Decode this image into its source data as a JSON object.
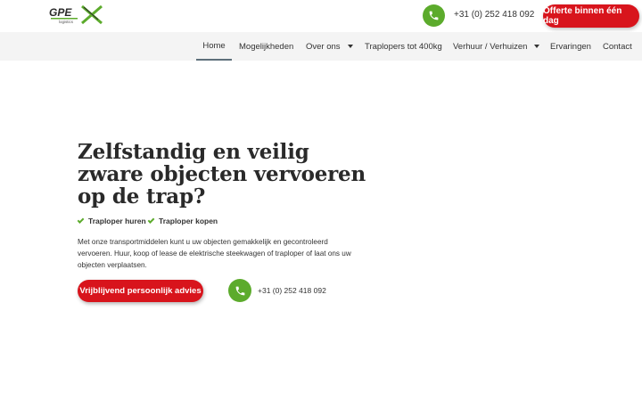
{
  "header": {
    "phone": "+31 (0) 252 418 092",
    "quote_button": "Offerte binnen één dag"
  },
  "nav": {
    "items": [
      {
        "label": "Home",
        "active": true
      },
      {
        "label": "Mogelijkheden"
      },
      {
        "label": "Over ons",
        "dropdown": true
      },
      {
        "label": "Traplopers tot 400kg"
      },
      {
        "label": "Verhuur / Verhuizen",
        "dropdown": true
      },
      {
        "label": "Ervaringen"
      },
      {
        "label": "Contact"
      }
    ]
  },
  "hero": {
    "title": "Zelfstandig en veilig zware objecten vervoeren op de trap?",
    "checks": [
      "Traploper huren",
      "Traploper kopen"
    ],
    "description": "Met onze transportmiddelen kunt u uw objecten gemakkelijk en gecontroleerd vervoeren. Huur, koop of lease de elektrische steekwagen of traploper of laat ons uw objecten verplaatsen.",
    "cta_button": "Vrijblijvend persoonlijk advies",
    "phone": "+31 (0) 252 418 092"
  },
  "colors": {
    "brand_red": "#d8141c",
    "brand_green": "#5cab2c"
  },
  "icons": {
    "phone": "phone-icon",
    "check": "check-icon",
    "dropdown": "chevron-down-icon"
  }
}
